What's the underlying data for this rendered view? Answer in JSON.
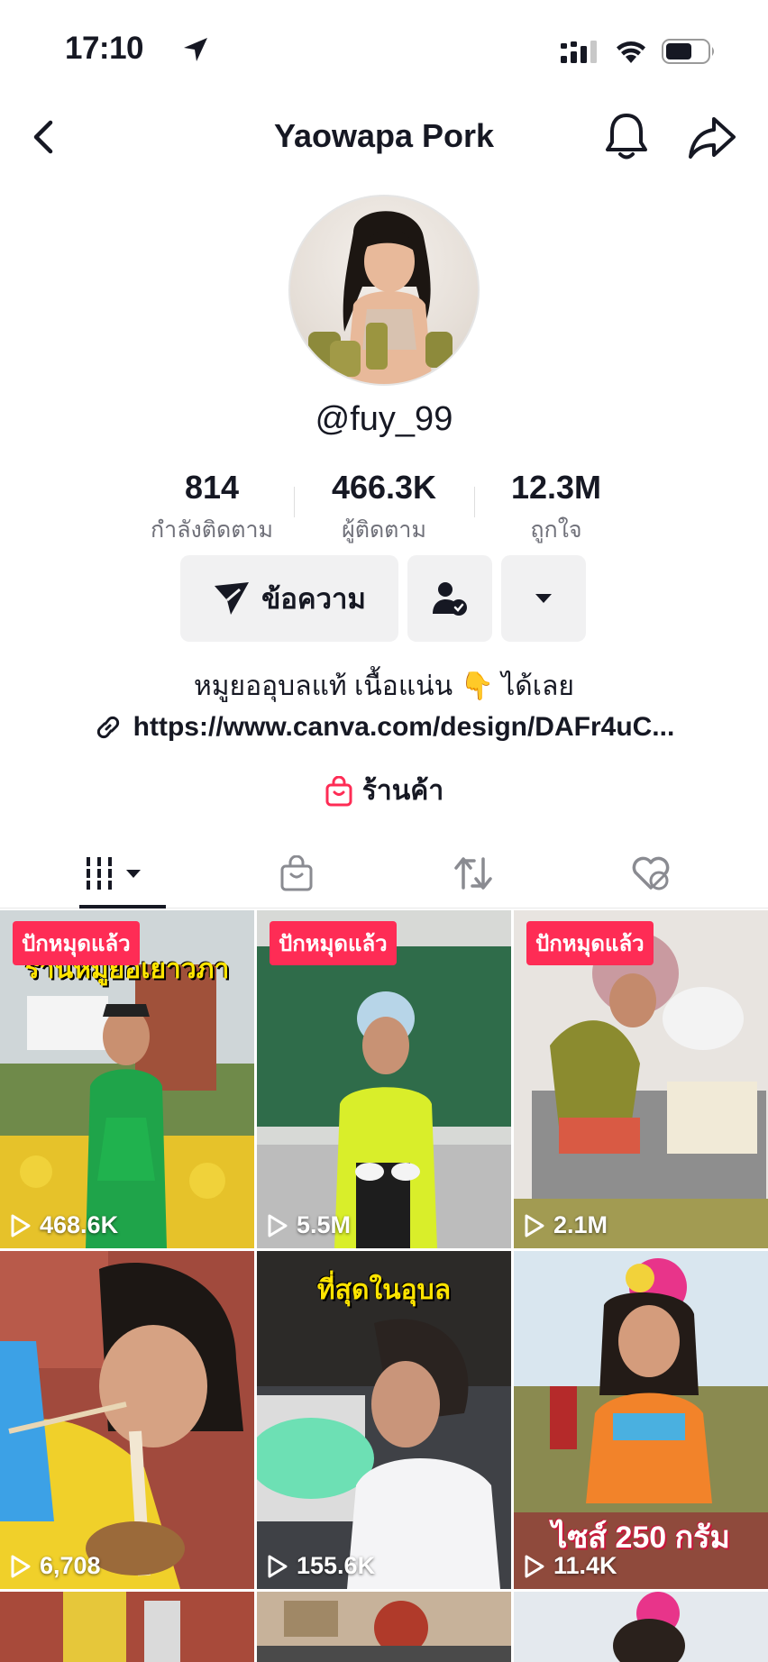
{
  "status_bar": {
    "time": "17:10"
  },
  "header": {
    "title": "Yaowapa Pork"
  },
  "profile": {
    "username": "@fuy_99",
    "stats": [
      {
        "value": "814",
        "label": "กำลังติดตาม"
      },
      {
        "value": "466.3K",
        "label": "ผู้ติดตาม"
      },
      {
        "value": "12.3M",
        "label": "ถูกใจ"
      }
    ],
    "message_button": "ข้อความ",
    "bio": "หมูยออุบลแท้ เนื้อแน่น 👇 ได้เลย",
    "link": "https://www.canva.com/design/DAFr4uC...",
    "shop_label": "ร้านค้า"
  },
  "colors": {
    "accent": "#fe2c55",
    "text": "#161823",
    "secondary": "#6f7079",
    "button_bg": "#f1f1f2"
  },
  "videos": [
    {
      "pinned": "ปักหมุดแล้ว",
      "views": "468.6K",
      "overlay": "ร้านหมูยอเยาวภา"
    },
    {
      "pinned": "ปักหมุดแล้ว",
      "views": "5.5M",
      "overlay": ""
    },
    {
      "pinned": "ปักหมุดแล้ว",
      "views": "2.1M",
      "overlay": ""
    },
    {
      "pinned": "",
      "views": "6,708",
      "overlay": ""
    },
    {
      "pinned": "",
      "views": "155.6K",
      "overlay": "ที่สุดในอุบล"
    },
    {
      "pinned": "",
      "views": "11.4K",
      "overlay": "ไซส์ 250 กรัม"
    }
  ]
}
